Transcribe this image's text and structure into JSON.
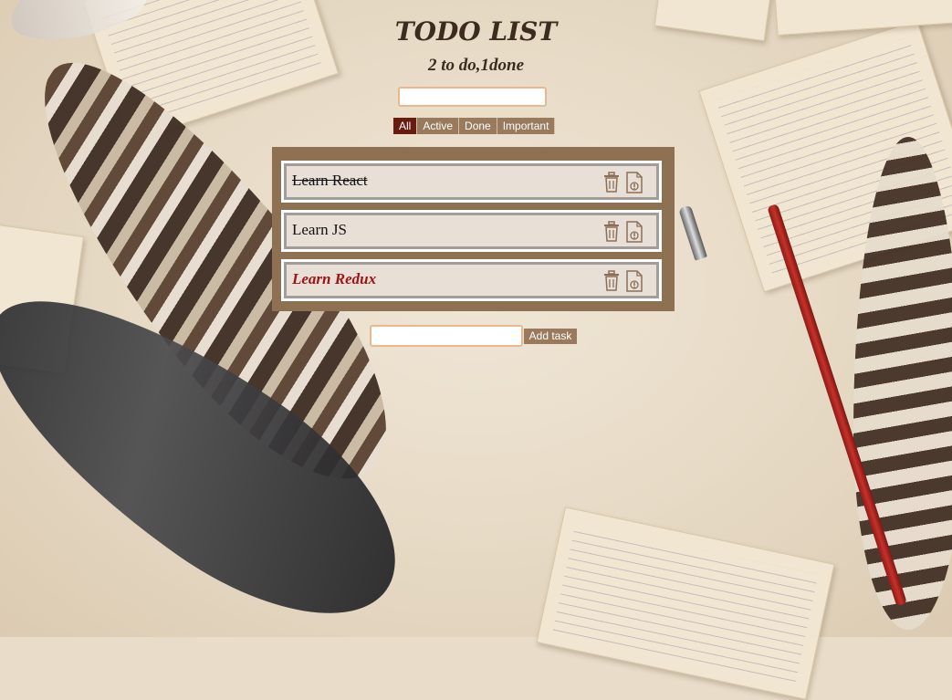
{
  "header": {
    "title": "TODO LIST",
    "subtitle": "2 to do,1done"
  },
  "search": {
    "value": "",
    "placeholder": ""
  },
  "filters": [
    {
      "label": "All",
      "active": true
    },
    {
      "label": "Active",
      "active": false
    },
    {
      "label": "Done",
      "active": false
    },
    {
      "label": "Important",
      "active": false
    }
  ],
  "todos": [
    {
      "label": "Learn React",
      "done": true,
      "important": false
    },
    {
      "label": "Learn JS",
      "done": false,
      "important": false
    },
    {
      "label": "Learn Redux",
      "done": false,
      "important": true
    }
  ],
  "icons": {
    "delete": "trash-icon",
    "important": "exclamation-document-icon"
  },
  "add_form": {
    "value": "",
    "placeholder": "",
    "button_label": "Add task"
  },
  "colors": {
    "accent": "#6a1b0f",
    "button": "#9a7a5c",
    "panel": "#8d7152",
    "important_text": "#a01414"
  }
}
